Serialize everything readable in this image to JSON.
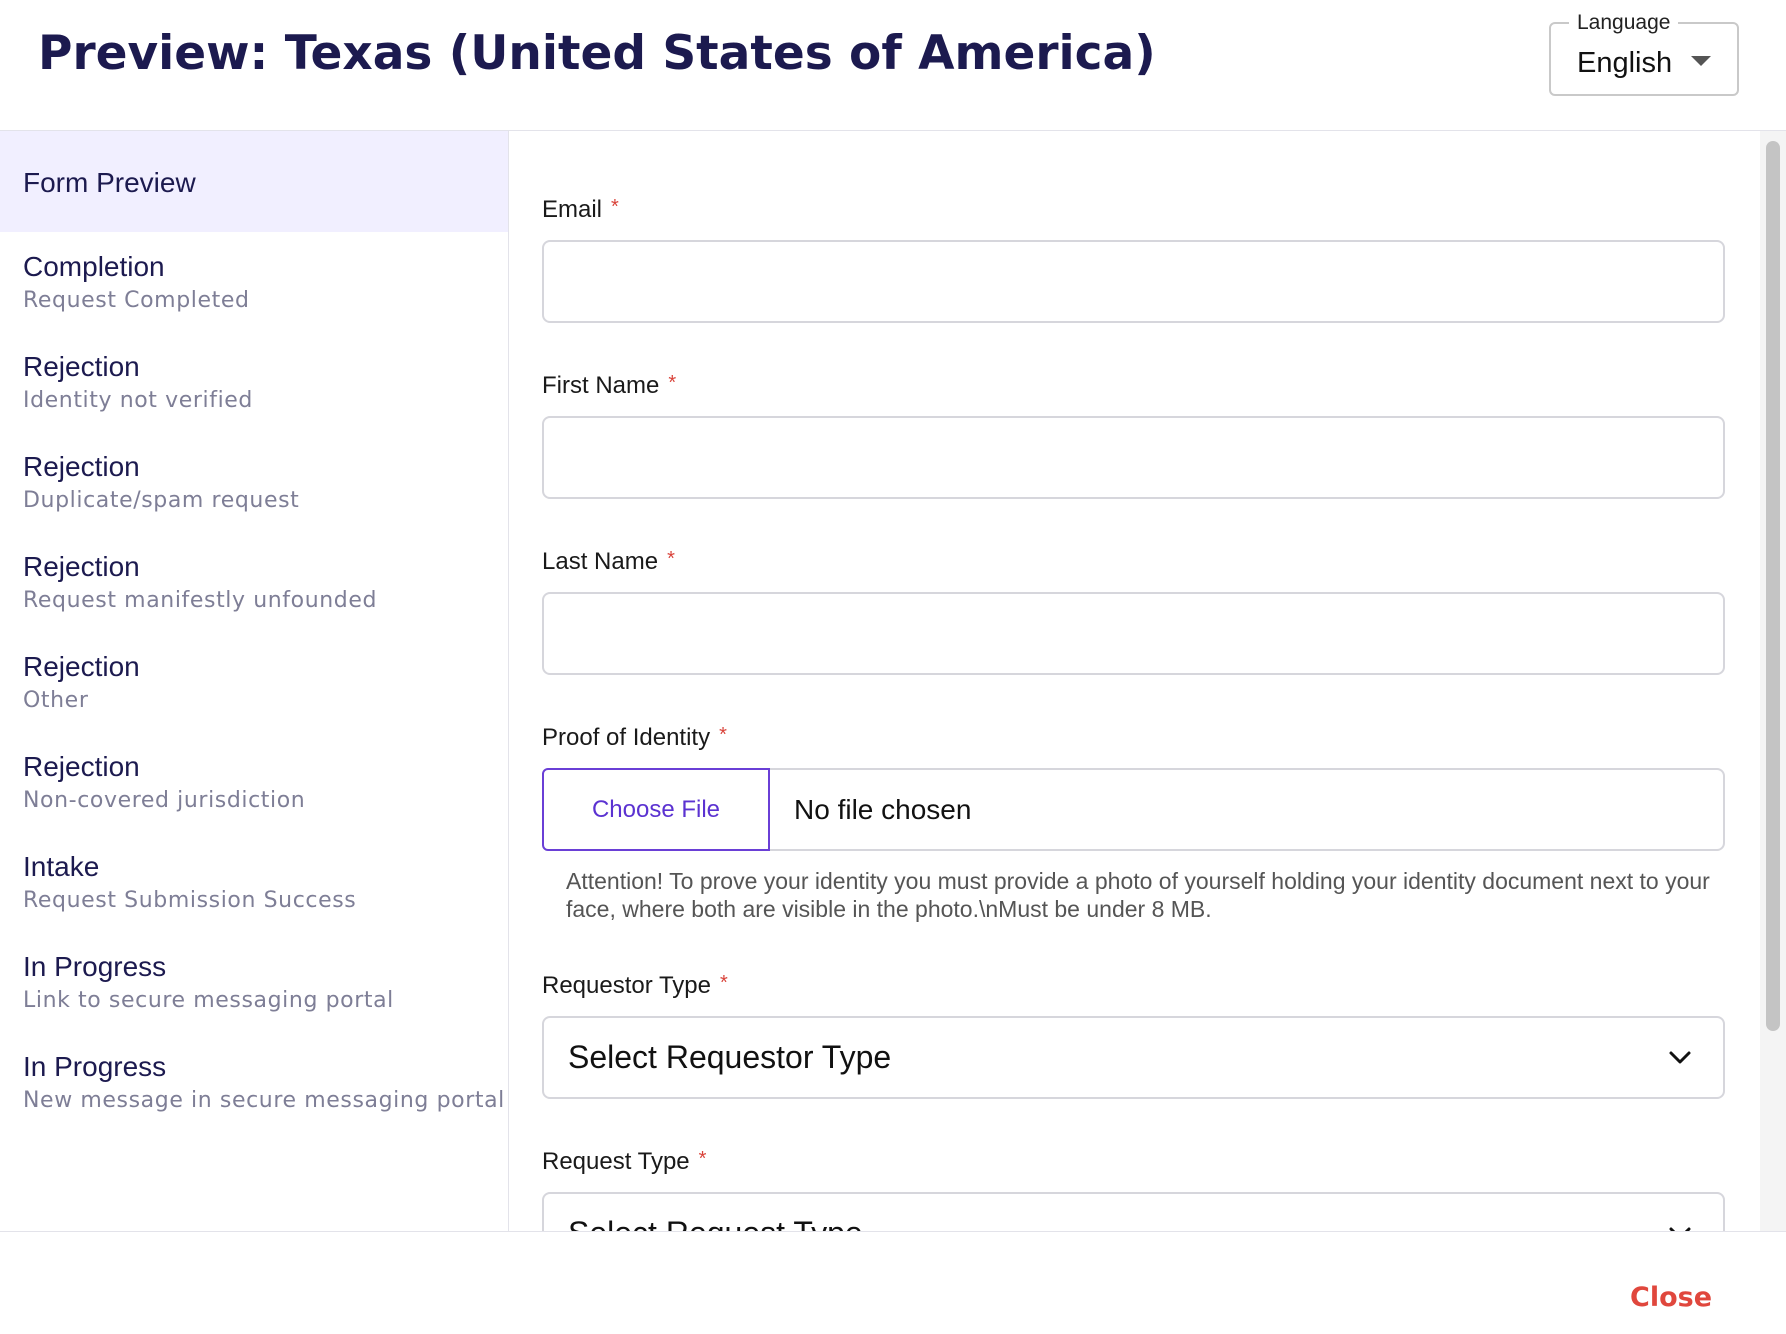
{
  "header": {
    "title": "Preview: Texas (United States of America)",
    "language": {
      "legend": "Language",
      "value": "English"
    }
  },
  "sidebar": {
    "active": "Form Preview",
    "items": [
      {
        "title": "Completion",
        "subtitle": "Request Completed"
      },
      {
        "title": "Rejection",
        "subtitle": "Identity not verified"
      },
      {
        "title": "Rejection",
        "subtitle": "Duplicate/spam request"
      },
      {
        "title": "Rejection",
        "subtitle": "Request manifestly unfounded"
      },
      {
        "title": "Rejection",
        "subtitle": "Other"
      },
      {
        "title": "Rejection",
        "subtitle": "Non-covered jurisdiction"
      },
      {
        "title": "Intake",
        "subtitle": "Request Submission Success"
      },
      {
        "title": "In Progress",
        "subtitle": "Link to secure messaging portal"
      },
      {
        "title": "In Progress",
        "subtitle": "New message in secure messaging portal"
      }
    ]
  },
  "form": {
    "required_mark": "*",
    "email_label": "Email",
    "first_name_label": "First Name",
    "last_name_label": "Last Name",
    "proof_label": "Proof of Identity",
    "choose_file": "Choose File",
    "no_file": "No file chosen",
    "proof_help": "Attention! To prove your identity you must provide a photo of yourself holding your identity document next to your face, where both are visible in the photo.\\nMust be under 8 MB.",
    "requestor_type_label": "Requestor Type",
    "requestor_type_placeholder": "Select Requestor Type",
    "request_type_label": "Request Type",
    "request_type_placeholder": "Select Request Type"
  },
  "footer": {
    "close_label": "Close"
  },
  "colors": {
    "title": "#1c1a4f",
    "active_bg": "#f1efff",
    "accent": "#5b32d1",
    "required": "#d9433a",
    "close": "#e0473d"
  }
}
